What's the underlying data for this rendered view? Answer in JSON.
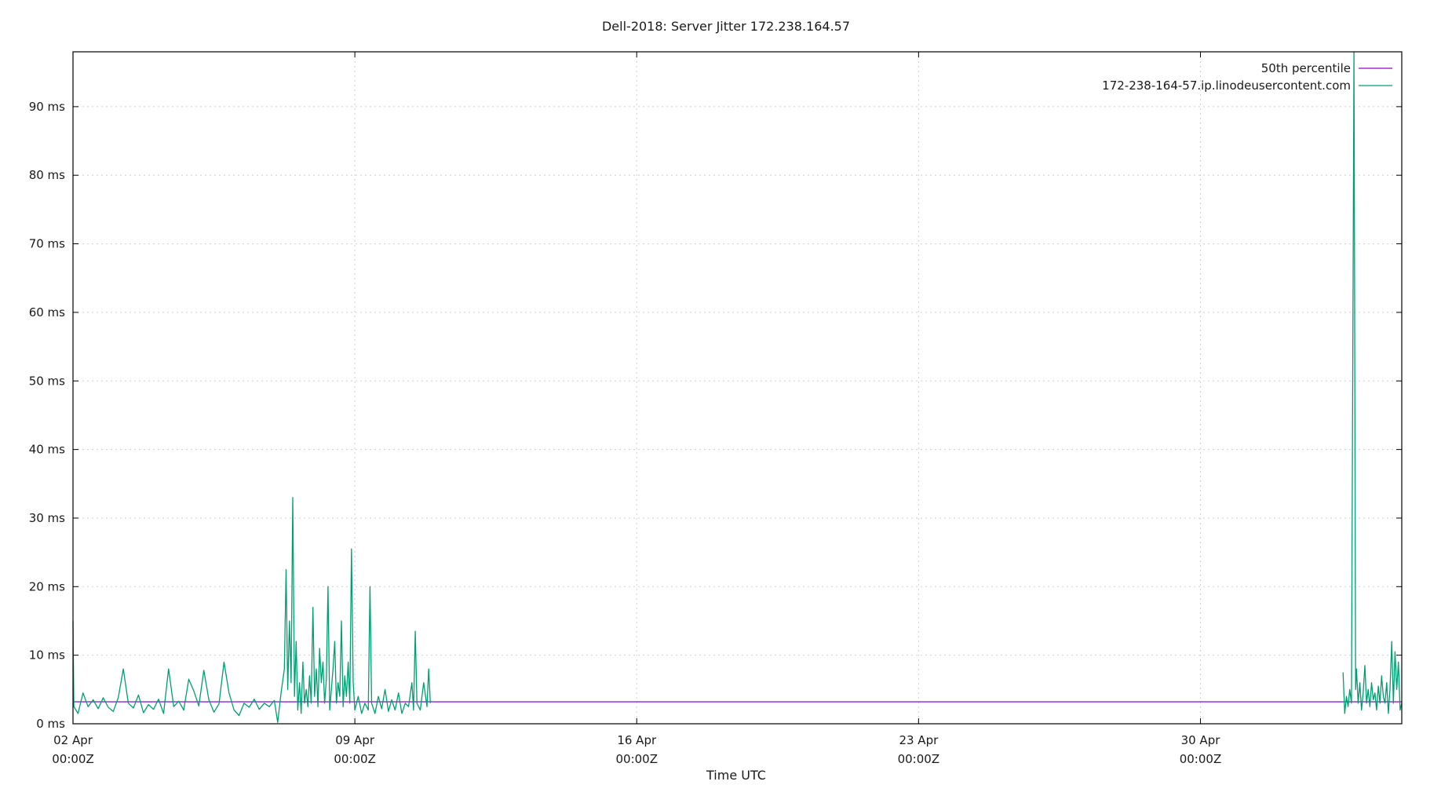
{
  "chart_data": {
    "type": "line",
    "title": "Dell-2018: Server Jitter 172.238.164.57",
    "xlabel": "Time UTC",
    "ylabel": "",
    "x_unit": "days",
    "xlim": [
      "2018-04-02T00:00Z",
      "2018-05-05T00:00Z"
    ],
    "ylim": [
      0,
      98
    ],
    "y_ticks": [
      0,
      10,
      20,
      30,
      40,
      50,
      60,
      70,
      80,
      90
    ],
    "y_tick_labels": [
      "0 ms",
      "10 ms",
      "20 ms",
      "30 ms",
      "40 ms",
      "50 ms",
      "60 ms",
      "70 ms",
      "80 ms",
      "90 ms"
    ],
    "x_ticks": [
      "2018-04-02T00:00Z",
      "2018-04-09T00:00Z",
      "2018-04-16T00:00Z",
      "2018-04-23T00:00Z",
      "2018-04-30T00:00Z"
    ],
    "x_tick_labels": [
      {
        "date": "02 Apr",
        "time": "00:00Z"
      },
      {
        "date": "09 Apr",
        "time": "00:00Z"
      },
      {
        "date": "16 Apr",
        "time": "00:00Z"
      },
      {
        "date": "23 Apr",
        "time": "00:00Z"
      },
      {
        "date": "30 Apr",
        "time": "00:00Z"
      }
    ],
    "grid": true,
    "legend_position": "top-right",
    "series": [
      {
        "name": "50th percentile",
        "color": "#9400d3",
        "points": [
          [
            "2018-04-02T00:00Z",
            3.2
          ],
          [
            "2018-05-05T00:00Z",
            3.2
          ]
        ]
      },
      {
        "name": "172-238-164-57.ip.linodeusercontent.com",
        "color": "#009e73",
        "points": [
          [
            "2018-04-02T00:00Z",
            15
          ],
          [
            "2018-04-02T00:30Z",
            2.5
          ],
          [
            "2018-04-02T03:00Z",
            1.5
          ],
          [
            "2018-04-02T06:00Z",
            4.5
          ],
          [
            "2018-04-02T09:00Z",
            2.5
          ],
          [
            "2018-04-02T12:00Z",
            3.5
          ],
          [
            "2018-04-02T15:00Z",
            2.2
          ],
          [
            "2018-04-02T18:00Z",
            3.8
          ],
          [
            "2018-04-02T21:00Z",
            2.4
          ],
          [
            "2018-04-03T00:00Z",
            1.8
          ],
          [
            "2018-04-03T03:00Z",
            3.8
          ],
          [
            "2018-04-03T06:00Z",
            8
          ],
          [
            "2018-04-03T09:00Z",
            3
          ],
          [
            "2018-04-03T12:00Z",
            2.3
          ],
          [
            "2018-04-03T15:00Z",
            4.2
          ],
          [
            "2018-04-03T18:00Z",
            1.6
          ],
          [
            "2018-04-03T21:00Z",
            2.8
          ],
          [
            "2018-04-04T00:00Z",
            2.1
          ],
          [
            "2018-04-04T03:00Z",
            3.6
          ],
          [
            "2018-04-04T06:00Z",
            1.5
          ],
          [
            "2018-04-04T09:00Z",
            8
          ],
          [
            "2018-04-04T12:00Z",
            2.5
          ],
          [
            "2018-04-04T15:00Z",
            3.3
          ],
          [
            "2018-04-04T18:00Z",
            2
          ],
          [
            "2018-04-04T21:00Z",
            6.5
          ],
          [
            "2018-04-05T00:00Z",
            4.8
          ],
          [
            "2018-04-05T03:00Z",
            2.6
          ],
          [
            "2018-04-05T06:00Z",
            7.8
          ],
          [
            "2018-04-05T09:00Z",
            3.5
          ],
          [
            "2018-04-05T12:00Z",
            1.7
          ],
          [
            "2018-04-05T15:00Z",
            2.9
          ],
          [
            "2018-04-05T18:00Z",
            9
          ],
          [
            "2018-04-05T21:00Z",
            4.5
          ],
          [
            "2018-04-06T00:00Z",
            2
          ],
          [
            "2018-04-06T03:00Z",
            1.2
          ],
          [
            "2018-04-06T06:00Z",
            3
          ],
          [
            "2018-04-06T09:00Z",
            2.4
          ],
          [
            "2018-04-06T12:00Z",
            3.6
          ],
          [
            "2018-04-06T15:00Z",
            2.1
          ],
          [
            "2018-04-06T18:00Z",
            3
          ],
          [
            "2018-04-06T21:00Z",
            2.5
          ],
          [
            "2018-04-07T00:00Z",
            3.4
          ],
          [
            "2018-04-07T02:00Z",
            0.2
          ],
          [
            "2018-04-07T04:00Z",
            4.5
          ],
          [
            "2018-04-07T06:00Z",
            8
          ],
          [
            "2018-04-07T07:00Z",
            22.5
          ],
          [
            "2018-04-07T08:00Z",
            5
          ],
          [
            "2018-04-07T09:00Z",
            15
          ],
          [
            "2018-04-07T10:00Z",
            6
          ],
          [
            "2018-04-07T11:00Z",
            33
          ],
          [
            "2018-04-07T12:00Z",
            4
          ],
          [
            "2018-04-07T13:00Z",
            12
          ],
          [
            "2018-04-07T14:00Z",
            2
          ],
          [
            "2018-04-07T15:00Z",
            6
          ],
          [
            "2018-04-07T16:00Z",
            1.5
          ],
          [
            "2018-04-07T17:00Z",
            9
          ],
          [
            "2018-04-07T18:00Z",
            3
          ],
          [
            "2018-04-07T19:00Z",
            5
          ],
          [
            "2018-04-07T20:00Z",
            2.5
          ],
          [
            "2018-04-07T21:00Z",
            7
          ],
          [
            "2018-04-07T22:00Z",
            3
          ],
          [
            "2018-04-07T23:00Z",
            17
          ],
          [
            "2018-04-08T00:00Z",
            4
          ],
          [
            "2018-04-08T01:00Z",
            8
          ],
          [
            "2018-04-08T02:00Z",
            2.5
          ],
          [
            "2018-04-08T03:00Z",
            11
          ],
          [
            "2018-04-08T04:00Z",
            6
          ],
          [
            "2018-04-08T05:00Z",
            9
          ],
          [
            "2018-04-08T06:00Z",
            3
          ],
          [
            "2018-04-08T07:00Z",
            6.5
          ],
          [
            "2018-04-08T08:00Z",
            20
          ],
          [
            "2018-04-08T09:00Z",
            2
          ],
          [
            "2018-04-08T10:00Z",
            5
          ],
          [
            "2018-04-08T11:00Z",
            8
          ],
          [
            "2018-04-08T12:00Z",
            12
          ],
          [
            "2018-04-08T13:00Z",
            3
          ],
          [
            "2018-04-08T14:00Z",
            6
          ],
          [
            "2018-04-08T15:00Z",
            4
          ],
          [
            "2018-04-08T16:00Z",
            15
          ],
          [
            "2018-04-08T17:00Z",
            2.5
          ],
          [
            "2018-04-08T18:00Z",
            7
          ],
          [
            "2018-04-08T19:00Z",
            4
          ],
          [
            "2018-04-08T20:00Z",
            9
          ],
          [
            "2018-04-08T21:00Z",
            3
          ],
          [
            "2018-04-08T22:00Z",
            25.5
          ],
          [
            "2018-04-08T23:00Z",
            6
          ],
          [
            "2018-04-09T00:00Z",
            2
          ],
          [
            "2018-04-09T02:00Z",
            4
          ],
          [
            "2018-04-09T04:00Z",
            1.5
          ],
          [
            "2018-04-09T06:00Z",
            3
          ],
          [
            "2018-04-09T08:00Z",
            2
          ],
          [
            "2018-04-09T09:00Z",
            20
          ],
          [
            "2018-04-09T10:00Z",
            3
          ],
          [
            "2018-04-09T12:00Z",
            1.5
          ],
          [
            "2018-04-09T14:00Z",
            4
          ],
          [
            "2018-04-09T16:00Z",
            2.2
          ],
          [
            "2018-04-09T18:00Z",
            5
          ],
          [
            "2018-04-09T20:00Z",
            1.8
          ],
          [
            "2018-04-09T22:00Z",
            3.5
          ],
          [
            "2018-04-10T00:00Z",
            2
          ],
          [
            "2018-04-10T02:00Z",
            4.5
          ],
          [
            "2018-04-10T04:00Z",
            1.5
          ],
          [
            "2018-04-10T06:00Z",
            3
          ],
          [
            "2018-04-10T08:00Z",
            2.5
          ],
          [
            "2018-04-10T10:00Z",
            6
          ],
          [
            "2018-04-10T11:00Z",
            2
          ],
          [
            "2018-04-10T12:00Z",
            13.5
          ],
          [
            "2018-04-10T13:00Z",
            3
          ],
          [
            "2018-04-10T15:00Z",
            2
          ],
          [
            "2018-04-10T17:00Z",
            6
          ],
          [
            "2018-04-10T19:00Z",
            2.5
          ],
          [
            "2018-04-10T20:00Z",
            8
          ],
          [
            "2018-04-10T21:00Z",
            3
          ],
          [
            "2018-05-03T13:00Z",
            7.5
          ],
          [
            "2018-05-03T14:00Z",
            1.5
          ],
          [
            "2018-05-03T15:00Z",
            4
          ],
          [
            "2018-05-03T16:00Z",
            2.5
          ],
          [
            "2018-05-03T17:00Z",
            5
          ],
          [
            "2018-05-03T18:00Z",
            3
          ],
          [
            "2018-05-03T19:30Z",
            98
          ],
          [
            "2018-05-03T20:30Z",
            5
          ],
          [
            "2018-05-03T21:00Z",
            8
          ],
          [
            "2018-05-03T22:00Z",
            3
          ],
          [
            "2018-05-03T23:00Z",
            6
          ],
          [
            "2018-05-04T00:00Z",
            2
          ],
          [
            "2018-05-04T01:00Z",
            4.5
          ],
          [
            "2018-05-04T02:00Z",
            8.5
          ],
          [
            "2018-05-04T03:00Z",
            3
          ],
          [
            "2018-05-04T04:00Z",
            5
          ],
          [
            "2018-05-04T05:00Z",
            2.5
          ],
          [
            "2018-05-04T06:00Z",
            6
          ],
          [
            "2018-05-04T07:00Z",
            3.5
          ],
          [
            "2018-05-04T08:00Z",
            4.5
          ],
          [
            "2018-05-04T09:00Z",
            2
          ],
          [
            "2018-05-04T10:00Z",
            5.5
          ],
          [
            "2018-05-04T11:00Z",
            3
          ],
          [
            "2018-05-04T12:00Z",
            7
          ],
          [
            "2018-05-04T13:00Z",
            4
          ],
          [
            "2018-05-04T14:00Z",
            3
          ],
          [
            "2018-05-04T15:00Z",
            6
          ],
          [
            "2018-05-04T16:00Z",
            1.5
          ],
          [
            "2018-05-04T17:00Z",
            5
          ],
          [
            "2018-05-04T18:00Z",
            12
          ],
          [
            "2018-05-04T19:00Z",
            3
          ],
          [
            "2018-05-04T20:00Z",
            10.5
          ],
          [
            "2018-05-04T21:00Z",
            5
          ],
          [
            "2018-05-04T22:00Z",
            9
          ],
          [
            "2018-05-04T23:00Z",
            2
          ],
          [
            "2018-05-05T00:00Z",
            3
          ]
        ]
      }
    ]
  }
}
